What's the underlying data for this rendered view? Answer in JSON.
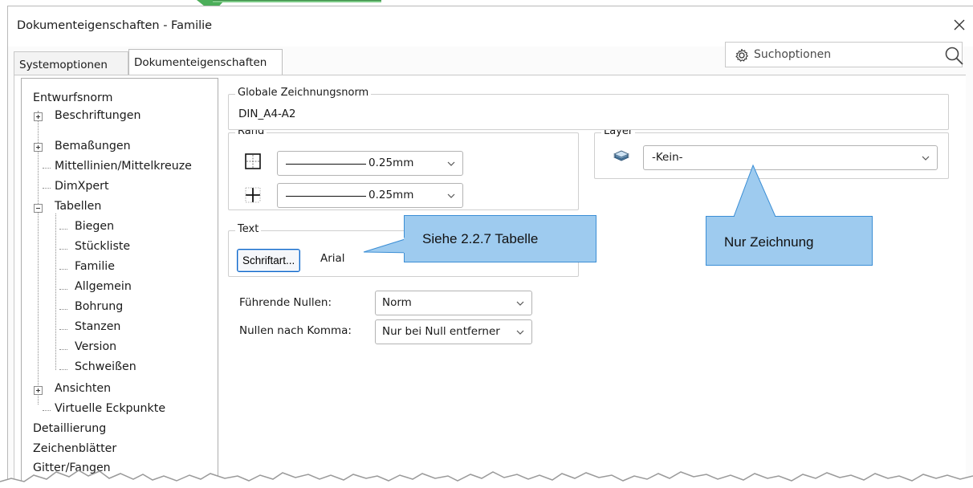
{
  "window": {
    "title": "Dokumenteigenschaften - Familie",
    "close_glyph": "×"
  },
  "tabs": [
    {
      "label": "Systemoptionen",
      "active": false
    },
    {
      "label": "Dokumenteigenschaften",
      "active": true
    }
  ],
  "search": {
    "placeholder": "Suchoptionen",
    "icon": "gear-icon"
  },
  "tree": {
    "items": [
      {
        "label": "Entwurfsnorm",
        "level": 0
      },
      {
        "label": "Beschriftungen",
        "level": 1,
        "expander": "plus"
      },
      {
        "label": "Bemaßungen",
        "level": 1,
        "expander": "plus"
      },
      {
        "label": "Mittellinien/Mittelkreuze",
        "level": 1
      },
      {
        "label": "DimXpert",
        "level": 1
      },
      {
        "label": "Tabellen",
        "level": 1,
        "expander": "minus"
      },
      {
        "label": "Biegen",
        "level": 2
      },
      {
        "label": "Stückliste",
        "level": 2
      },
      {
        "label": "Familie",
        "level": 2,
        "selected": true
      },
      {
        "label": "Allgemein",
        "level": 2
      },
      {
        "label": "Bohrung",
        "level": 2
      },
      {
        "label": "Stanzen",
        "level": 2
      },
      {
        "label": "Version",
        "level": 2
      },
      {
        "label": "Schweißen",
        "level": 2
      },
      {
        "label": "Ansichten",
        "level": 1,
        "expander": "plus"
      },
      {
        "label": "Virtuelle Eckpunkte",
        "level": 1
      },
      {
        "label": "Detaillierung",
        "level": 0
      },
      {
        "label": "Zeichenblätter",
        "level": 0
      },
      {
        "label": "Gitter/Fangen",
        "level": 0
      }
    ]
  },
  "global_norm": {
    "legend": "Globale Zeichnungsnorm",
    "value": "DIN_A4-A2"
  },
  "rand": {
    "legend": "Rand",
    "outer": {
      "value": "0.25mm"
    },
    "inner": {
      "value": "0.25mm"
    }
  },
  "layer": {
    "legend": "Layer",
    "value": "-Kein-"
  },
  "text_group": {
    "legend": "Text",
    "button": "Schriftart...",
    "font": "Arial"
  },
  "fuehrende_nullen": {
    "label": "Führende Nullen:",
    "value": "Norm"
  },
  "nullen_komma": {
    "label": "Nullen nach Komma:",
    "value": "Nur bei Null entferner"
  },
  "callouts": {
    "text_note": "Siehe 2.2.7 Tabelle",
    "layer_note": "Nur Zeichnung"
  },
  "colors": {
    "callout_fill": "#9ecbef",
    "callout_border": "#3b8ed5",
    "arrow_green": "#4cae5a",
    "button_border": "#0a64c8"
  }
}
